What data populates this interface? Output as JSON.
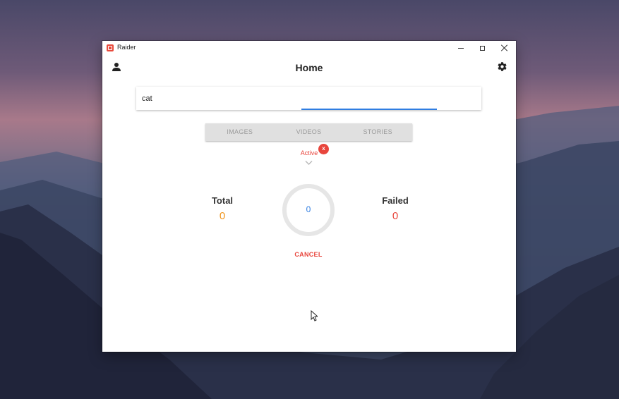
{
  "window": {
    "app_title": "Raider",
    "icon": "raider-app-icon"
  },
  "header": {
    "title": "Home",
    "left_icon": "person-icon",
    "right_icon": "gear-icon"
  },
  "search": {
    "value": "cat",
    "placeholder": ""
  },
  "tabs": [
    {
      "label": "IMAGES"
    },
    {
      "label": "VIDEOS"
    },
    {
      "label": "STORIES"
    }
  ],
  "status": {
    "active_label": "Active",
    "badge_label": "x"
  },
  "stats": {
    "total_label": "Total",
    "total_value": "0",
    "failed_label": "Failed",
    "failed_value": "0",
    "progress_value": "0"
  },
  "actions": {
    "cancel_label": "CANCEL"
  },
  "colors": {
    "accent_blue": "#2f7de1",
    "danger_red": "#e8453c",
    "total_orange": "#f0961f"
  }
}
